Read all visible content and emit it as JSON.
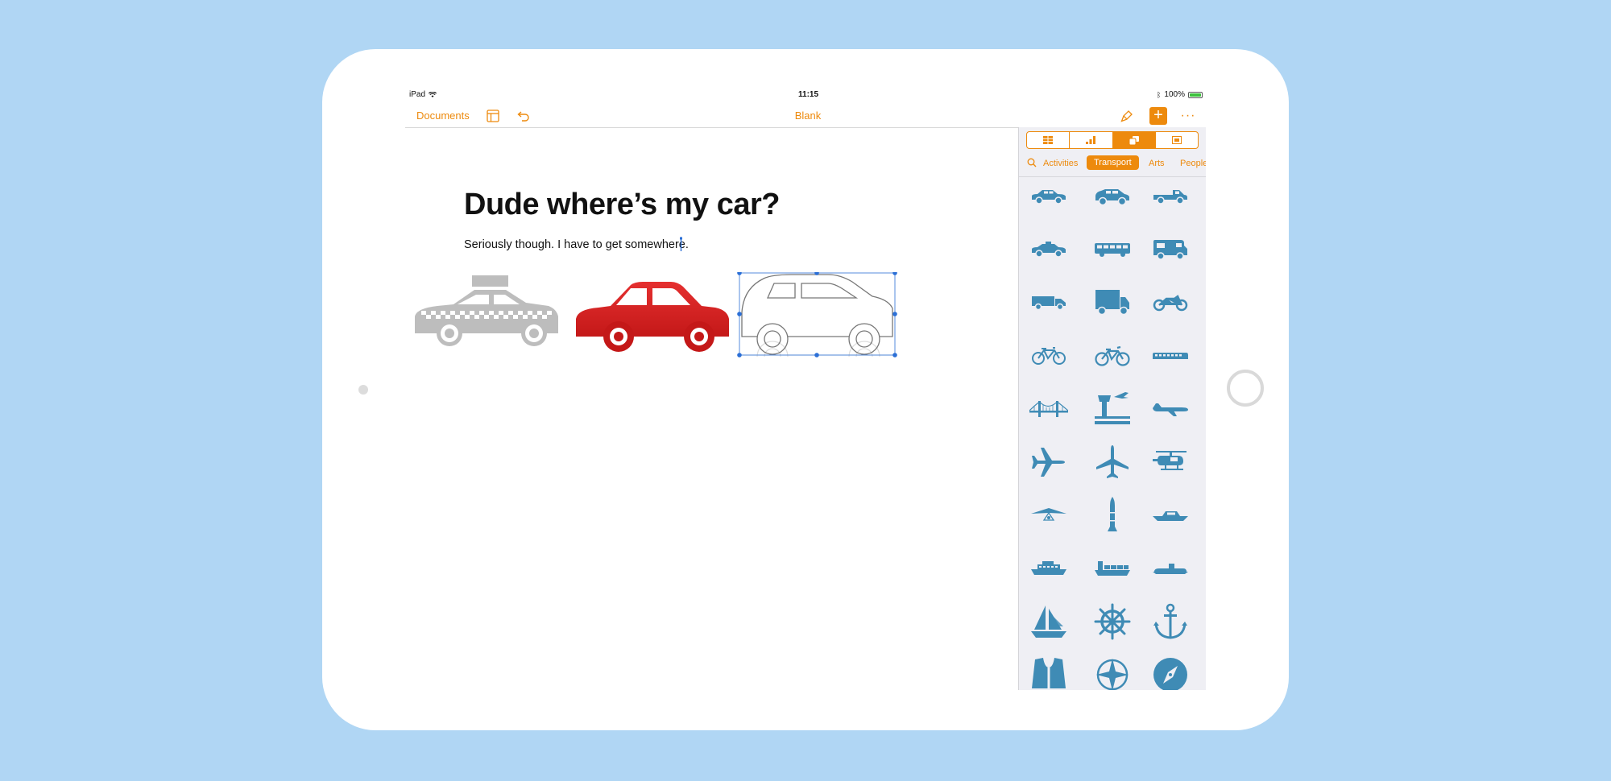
{
  "status_bar": {
    "device": "iPad",
    "time": "11:15",
    "battery": "100%"
  },
  "toolbar": {
    "documents": "Documents",
    "title": "Blank"
  },
  "document": {
    "title": "Dude where’s my car?",
    "subtitle": "Seriously though. I have to get somewhere."
  },
  "panel": {
    "tabs": [
      "table-icon",
      "chart-icon",
      "shapes-icon",
      "media-icon"
    ],
    "active_tab": 2,
    "categories": [
      "Activities",
      "Transport",
      "Arts",
      "People"
    ],
    "active_category": "Transport",
    "shapes": [
      "sedan",
      "hatchback",
      "pickup-truck",
      "taxi",
      "bus",
      "camper-van",
      "delivery-truck",
      "box-truck",
      "motorcycle",
      "bicycle",
      "mountain-bike",
      "train",
      "bridge",
      "control-tower",
      "airliner-side",
      "airplane-top",
      "jet-top",
      "helicopter",
      "hang-glider",
      "rocket",
      "speedboat",
      "ferry",
      "cargo-ship",
      "submarine",
      "sailboat",
      "ship-wheel",
      "anchor",
      "life-vest",
      "compass-rose",
      "compass"
    ]
  },
  "colors": {
    "accent": "#ed8a0d",
    "shape": "#3f8bb5",
    "red_car": "#dc2424",
    "taxi": "#bdbdbd",
    "selection": "#2b6fd6"
  }
}
